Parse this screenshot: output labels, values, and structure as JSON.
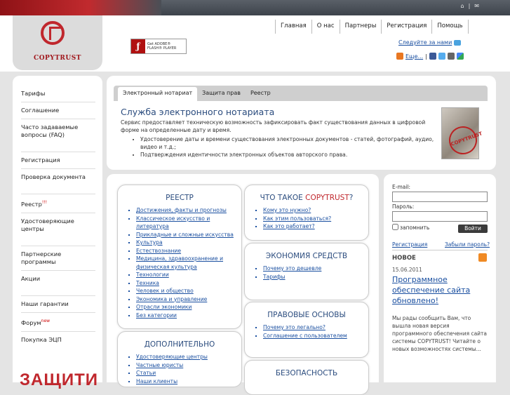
{
  "logo": {
    "text": "COPYTRUST"
  },
  "top_icons": [
    "home-icon",
    "mail-icon"
  ],
  "nav": [
    "Главная",
    "О нас",
    "Партнеры",
    "Регистрация",
    "Помощь"
  ],
  "flash": {
    "line1": "Get ADOBE®",
    "line2": "FLASH® PLAYER"
  },
  "follow": "Следуйте за нами",
  "share": {
    "more": "Еще..."
  },
  "sidebar": [
    {
      "label": "Тарифы"
    },
    {
      "label": "Соглашение"
    },
    {
      "label": "Часто задаваемые вопросы (FAQ)"
    },
    {
      "label": "Регистрация"
    },
    {
      "label": "Проверка документа"
    },
    {
      "label": "Реестр",
      "badge": "!!!"
    },
    {
      "label": "Удостоверяющие центры"
    },
    {
      "label": "Партнерские программы"
    },
    {
      "label": "Акции"
    },
    {
      "label": "Наши гарантии"
    },
    {
      "label": "Форум",
      "badge": "new"
    },
    {
      "label": "Покупка ЭЦП"
    }
  ],
  "promo": "ЗАЩИТИ",
  "notary": {
    "tabs": [
      "Электронный нотариат",
      "Защита прав",
      "Реестр"
    ],
    "title": "Служба электронного нотариата",
    "text": "Сервис предоставляет техническую возможность зафиксировать факт существования данных в цифровой форме на определенные дату и время.",
    "bullets": [
      "Удостоверение даты и времени существования электронных документов - статей, фотографий, аудио, видео и т.д.;",
      "Подтверждения идентичности электронных объектов авторского права."
    ],
    "stamp": "COPYTRUST"
  },
  "registry": {
    "title": "РЕЕСТР",
    "items": [
      "Достижения, факты и прогнозы",
      "Классическое искусство и литература",
      "Прикладные и сложные искусства",
      "Культура",
      "Естествознание",
      "Медицина, здравоохранение и физическая культура",
      "Технологии",
      "Техника",
      "Человек и общество",
      "Экономика и управление",
      "Отрасли экономики",
      "Без категории"
    ]
  },
  "extra": {
    "title": "ДОПОЛНИТЕЛЬНО",
    "items": [
      "Удостоверяющие центры",
      "Частные юристы",
      "Статьи",
      "Наши клиенты"
    ]
  },
  "what": {
    "title_a": "ЧТО ТАКОЕ ",
    "title_b": "COPYTRUST",
    "title_c": "?",
    "items": [
      "Кому это нужно?",
      "Как этим пользоваться?",
      "Как это работает?"
    ]
  },
  "economy": {
    "title": "ЭКОНОМИЯ СРЕДСТВ",
    "items": [
      "Почему это дешевле",
      "Тарифы"
    ]
  },
  "legal": {
    "title": "ПРАВОВЫЕ ОСНОВЫ",
    "items": [
      "Почему это легально?",
      "Соглашение с пользователем"
    ]
  },
  "security": {
    "title": "БЕЗОПАСНОСТЬ"
  },
  "login": {
    "email_label": "E-mail:",
    "password_label": "Пароль:",
    "remember": "запомнить",
    "submit": "Войти",
    "register": "Регистрация",
    "forgot": "Забыли пароль?"
  },
  "news": {
    "heading": "НОВОЕ",
    "date": "15.06.2011",
    "title": "Программное обеспечение сайта обновлено!",
    "text": "Мы рады сообщить Вам, что вышла новая версия программного обеспечения сайта системы COPYTRUST! Читайте о новых возможностях системы..."
  }
}
